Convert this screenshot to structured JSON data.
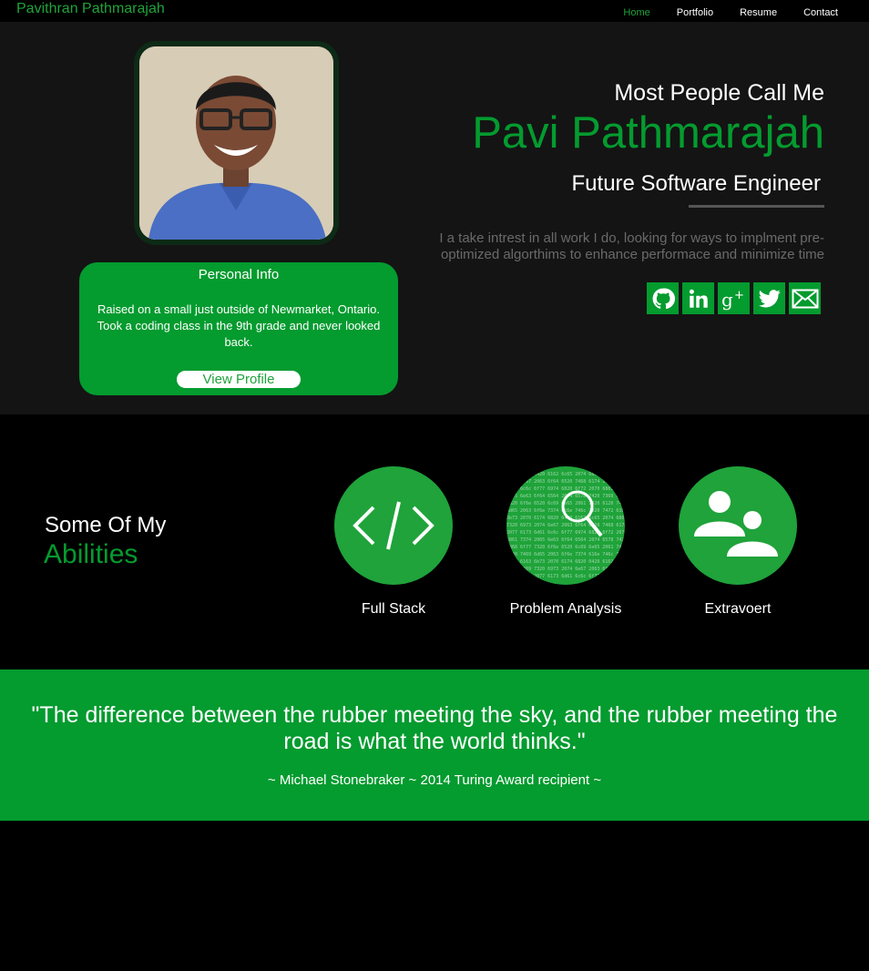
{
  "nav": {
    "brand": "Pavithran Pathmarajah",
    "links": [
      "Home",
      "Portfolio",
      "Resume",
      "Contact"
    ]
  },
  "hero": {
    "intro": "Most People Call Me",
    "name": "Pavi Pathmarajah",
    "role": "Future Software Engineer",
    "bio": "I a take intrest in all work I do, looking for ways to implment pre-optimized algorthims to enhance performace and minimize time",
    "socials": [
      "github-icon",
      "linkedin-icon",
      "google-plus-icon",
      "twitter-icon",
      "email-icon"
    ]
  },
  "info_card": {
    "title": "Personal Info",
    "text": "Raised on a small just outside of Newmarket, Ontario. Took a coding class in the 9th grade and never looked back.",
    "button": "View Profile"
  },
  "abilities": {
    "heading_top": "Some Of My",
    "heading_bottom": "Abilities",
    "items": [
      {
        "label": "Full Stack",
        "icon": "code-icon"
      },
      {
        "label": "Problem Analysis",
        "icon": "magnifier-icon"
      },
      {
        "label": "Extravoert",
        "icon": "people-icon"
      }
    ]
  },
  "quote": {
    "text": "\"The difference between the rubber meeting the sky, and the rubber meeting the road is what the world thinks.\"",
    "cite": "~ Michael Stonebraker ~ 2014 Turing Award recipient ~"
  },
  "colors": {
    "accent": "#049b2f",
    "background": "#000000",
    "hero_bg": "#141414"
  }
}
